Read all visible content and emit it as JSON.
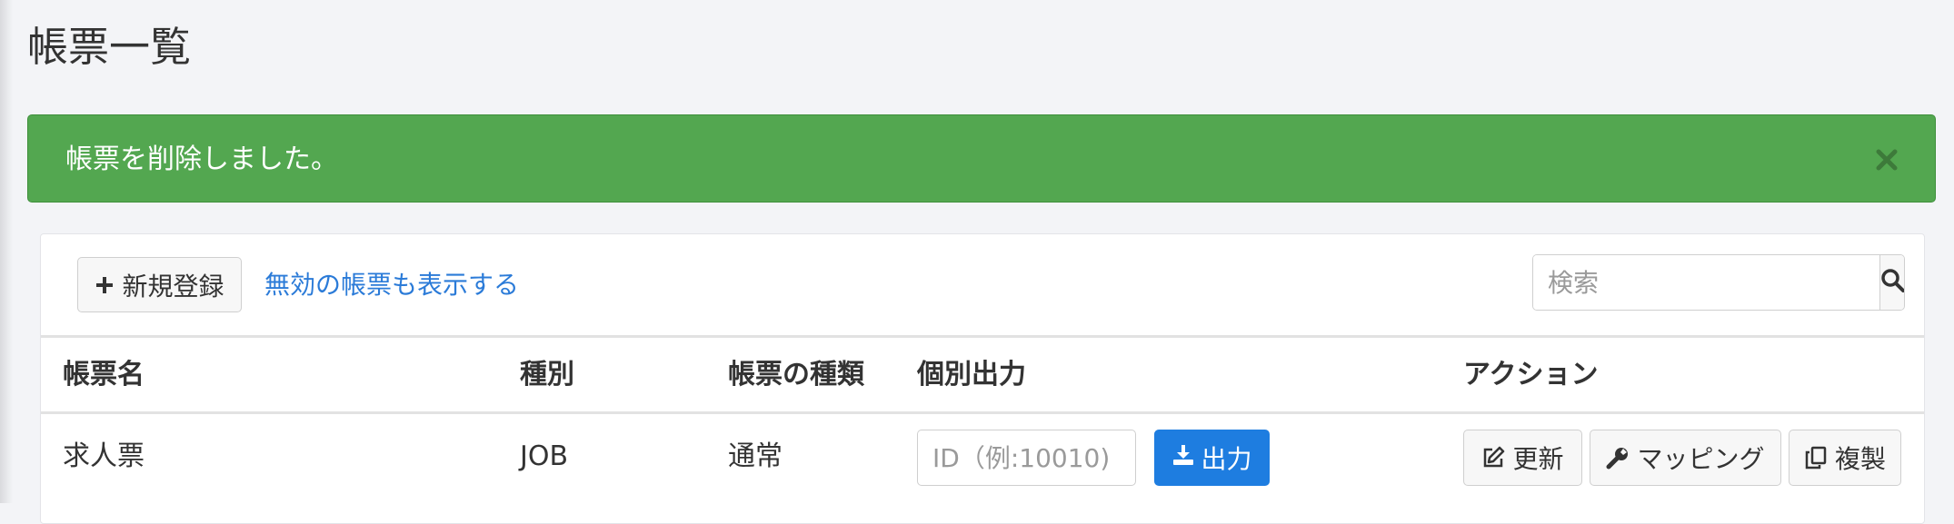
{
  "page": {
    "title": "帳票一覧"
  },
  "alert": {
    "message": "帳票を削除しました。",
    "close_icon": "close-icon",
    "color": "#53a750"
  },
  "toolbar": {
    "new_label": "新規登録",
    "new_icon": "plus-icon",
    "show_inactive_label": "無効の帳票も表示する",
    "search_placeholder": "検索",
    "search_icon": "search-icon"
  },
  "table": {
    "headers": [
      "帳票名",
      "種別",
      "帳票の種類",
      "個別出力",
      "アクション"
    ],
    "rows": [
      {
        "name": "求人票",
        "type": "JOB",
        "kind": "通常",
        "id_placeholder": "ID（例:10010)",
        "export_label": "出力",
        "export_icon": "download-icon",
        "actions": {
          "update_label": "更新",
          "update_icon": "edit-icon",
          "mapping_label": "マッピング",
          "mapping_icon": "wrench-icon",
          "copy_label": "複製",
          "copy_icon": "copy-icon"
        }
      }
    ]
  },
  "colors": {
    "accent": "#1e7de0",
    "link": "#2b7bd8",
    "success": "#53a750"
  }
}
